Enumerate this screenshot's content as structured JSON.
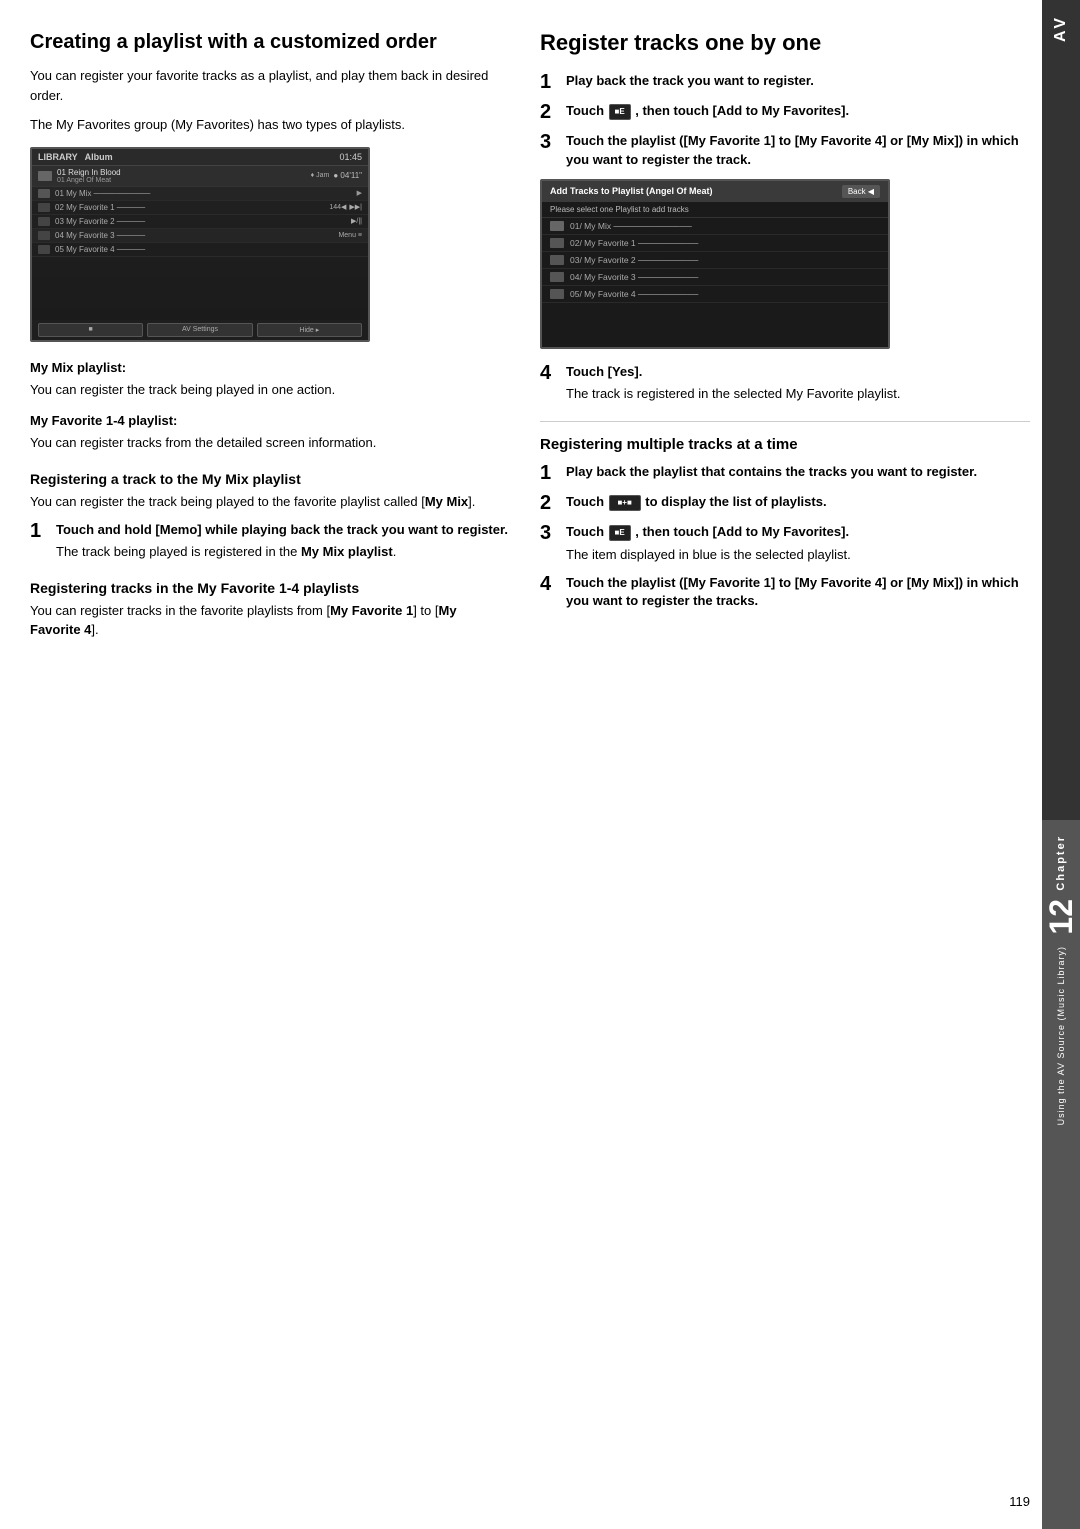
{
  "page": {
    "number": "119",
    "left_section": {
      "title": "Creating a playlist with a customized order",
      "intro_text": "You can register your favorite tracks as a playlist, and play them back in desired order.",
      "intro_text2": "The My Favorites group (My Favorites) has two types of playlists.",
      "screenshot_alt": "Library screen showing playlists",
      "my_mix_label": "My Mix playlist:",
      "my_mix_text": "You can register the track being played in one action.",
      "my_favorite_label": "My Favorite 1-4 playlist:",
      "my_favorite_text": "You can register tracks from the detailed screen information.",
      "registering_track_title": "Registering a track to the My Mix playlist",
      "registering_track_text": "You can register the track being played to the favorite playlist called [My Mix].",
      "step1_main": "Touch and hold [Memo] while playing back the track you want to register.",
      "step1_sub": "The track being played is registered in the My Mix playlist.",
      "my_mix_bold": "My",
      "mix_playlist_bold": "Mix playlist",
      "registering_my_favorite_title": "Registering tracks in the My Favorite 1-4 playlists",
      "registering_my_favorite_text": "You can register tracks in the favorite playlists from [My Favorite 1] to [My Favorite 4].",
      "my_fav1_bold": "My Favorite 1",
      "my_fav4_bold": "My Favorite 4"
    },
    "right_section": {
      "title": "Register tracks one by one",
      "step1_main": "Play back the track you want to register.",
      "step2_main": "Touch",
      "step2_icon": "■E■",
      "step2_rest": ", then touch [Add to My Favorites].",
      "step2_add_to_my_fav": "Add to My Favorites",
      "step3_main": "Touch the playlist ([My Favorite 1] to [My Favorite 4] or [My Mix]) in which you want to register the track.",
      "screenshot2_alt": "Add Tracks to Playlist screen",
      "screenshot2_title": "Add Tracks to Playlist (Angel Of Meat)",
      "screenshot2_subtitle": "Please select one Playlist to add tracks",
      "screenshot2_items": [
        "01 My Mix",
        "02/ My Favorite 1",
        "03/ My Favorite 2",
        "04/ My Favorite 3",
        "05/ My Favorite 4"
      ],
      "step4_main": "Touch [Yes].",
      "step4_sub": "The track is registered in the selected My Favorite playlist.",
      "registering_multiple_title": "Registering multiple tracks at a time",
      "mult_step1_main": "Play back the playlist that contains the tracks you want to register.",
      "mult_step2_main": "Touch",
      "mult_step2_icon": "■+■",
      "mult_step2_rest": "to display the list of playlists.",
      "mult_step3_main": "Touch",
      "mult_step3_icon": "■E■",
      "mult_step3_rest": ", then touch [Add to My Favorites].",
      "mult_step3_sub": "The item displayed in blue is the selected playlist.",
      "mult_step4_main": "Touch the playlist ([My Favorite 1] to [My Favorite 4] or [My Mix]) in which you want to register the tracks."
    },
    "sidebar": {
      "av_label": "AV",
      "chapter_label": "Chapter",
      "chapter_number": "12",
      "source_label": "Using the AV Source (Music Library)"
    }
  }
}
